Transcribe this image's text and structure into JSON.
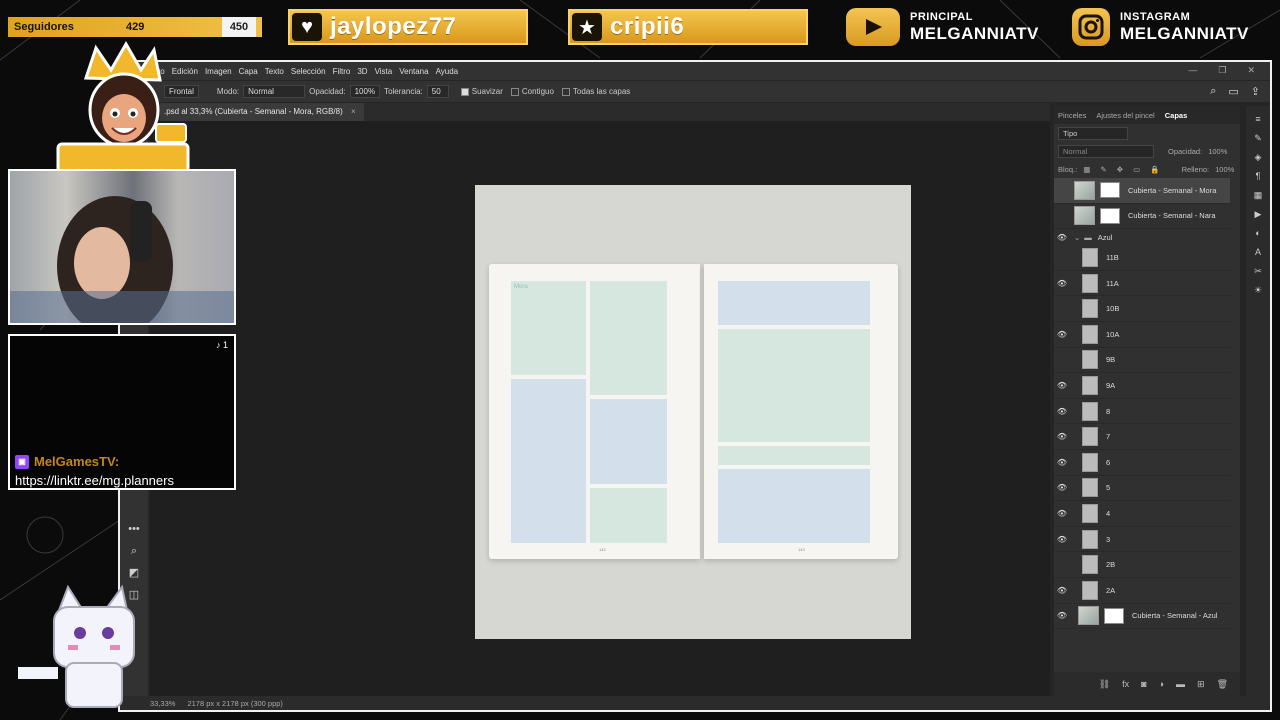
{
  "stream": {
    "followers_label": "Seguidores",
    "followers_current": "429",
    "followers_goal": "450",
    "alert_follow_name": "jaylopez77",
    "alert_sub_name": "cripii6",
    "youtube_small": "PRINCIPAL",
    "youtube_big": "MELGANNIATV",
    "instagram_small": "INSTAGRAM",
    "instagram_big": "MELGANNIATV",
    "chat_user": "MelGamesTV:",
    "chat_message": "https://linktr.ee/mg.planners",
    "tiktok_count": "1",
    "brand_colors": {
      "gold": "#e6a72a",
      "twitch": "#9146ff"
    }
  },
  "photoshop": {
    "menu": [
      "Archivo",
      "Edición",
      "Imagen",
      "Capa",
      "Texto",
      "Selección",
      "Filtro",
      "3D",
      "Vista",
      "Ventana",
      "Ayuda"
    ],
    "options": {
      "view": "Frontal",
      "mode_label": "Modo:",
      "mode_value": "Normal",
      "opacity_label": "Opacidad:",
      "opacity_value": "100%",
      "tolerance_label": "Tolerancia:",
      "tolerance_value": "50",
      "smooth_label": "Suavizar",
      "contiguous_label": "Contiguo",
      "all_layers_label": "Todas las capas"
    },
    "document_tab": ".psd al 33,3% (Cubierta - Semanal - Mora, RGB/8)",
    "status": {
      "zoom": "33,33%",
      "doc_info": "2178 px x 2178 px (300 ppp)"
    },
    "mockup": {
      "left_page_number": "142",
      "right_page_number": "143",
      "corner_label": "Mora"
    },
    "panels": {
      "tabs": [
        "Pinceles",
        "Ajustes del pincel",
        "Capas"
      ],
      "filter_type": "Tipo",
      "blend_mode": "Normal",
      "opacity_label": "Opacidad:",
      "opacity_value": "100%",
      "lock_label": "Bloq.:",
      "fill_label": "Relleno:",
      "fill_value": "100%",
      "layers_top": [
        {
          "name": "Cubierta - Semanal - Mora",
          "visible": false,
          "selected": true
        },
        {
          "name": "Cubierta - Semanal - Nara",
          "visible": false,
          "selected": false
        }
      ],
      "group_name": "Azul",
      "group_layers": [
        {
          "name": "11B",
          "visible": false
        },
        {
          "name": "11A",
          "visible": true
        },
        {
          "name": "10B",
          "visible": false
        },
        {
          "name": "10A",
          "visible": true
        },
        {
          "name": "9B",
          "visible": false
        },
        {
          "name": "9A",
          "visible": true
        },
        {
          "name": "8",
          "visible": true
        },
        {
          "name": "7",
          "visible": true
        },
        {
          "name": "6",
          "visible": true
        },
        {
          "name": "5",
          "visible": true
        },
        {
          "name": "4",
          "visible": true
        },
        {
          "name": "3",
          "visible": true
        },
        {
          "name": "2B",
          "visible": false
        },
        {
          "name": "2A",
          "visible": true
        }
      ],
      "layer_bottom": {
        "name": "Cubierta - Semanal - Azul",
        "visible": true
      }
    }
  }
}
